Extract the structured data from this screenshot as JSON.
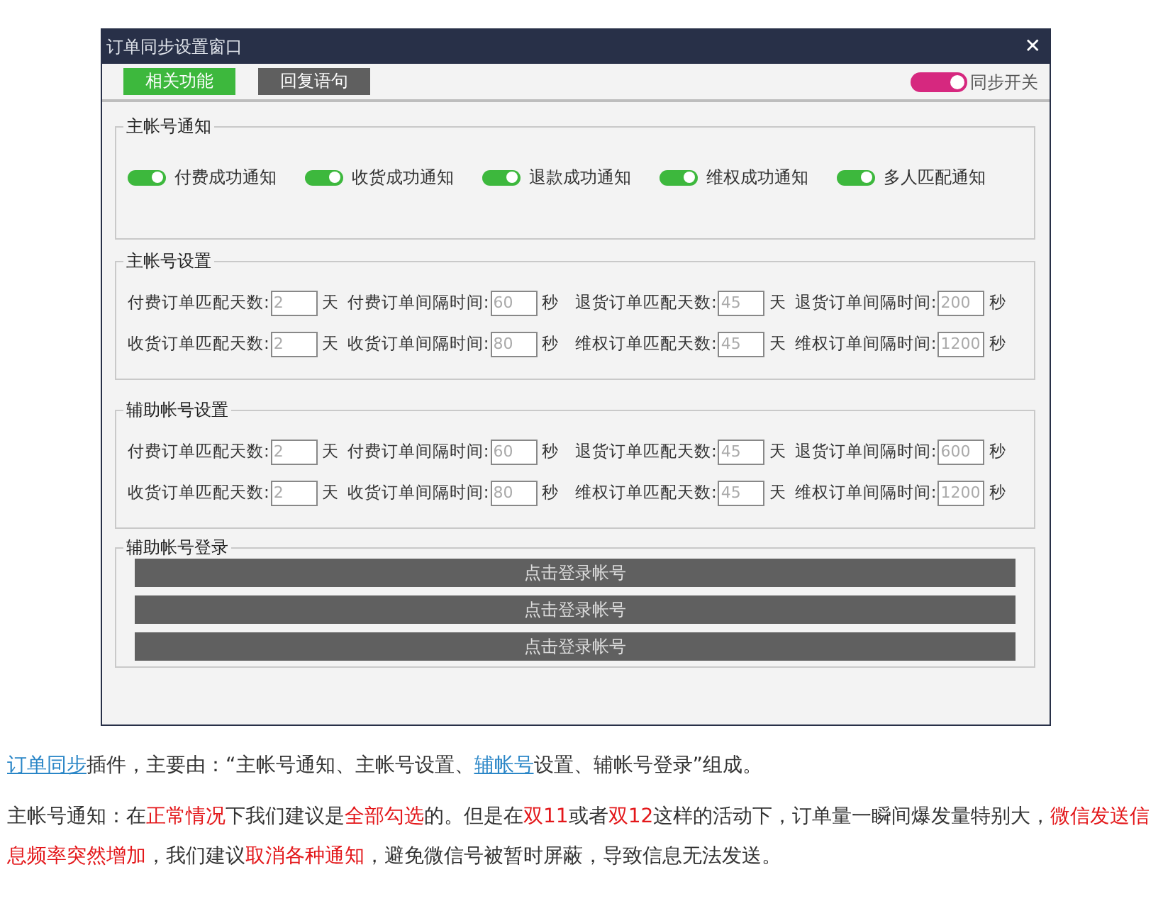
{
  "window": {
    "title": "订单同步设置窗口",
    "close": "✕"
  },
  "tabs": [
    {
      "label": "相关功能",
      "selected": true
    },
    {
      "label": "回复语句",
      "selected": false
    }
  ],
  "sync_switch": {
    "label": "同步开关",
    "on": true
  },
  "notifications": {
    "title": "主帐号通知",
    "items": [
      {
        "label": "付费成功通知",
        "on": true
      },
      {
        "label": "收货成功通知",
        "on": true
      },
      {
        "label": "退款成功通知",
        "on": true
      },
      {
        "label": "维权成功通知",
        "on": true
      },
      {
        "label": "多人匹配通知",
        "on": true
      }
    ]
  },
  "settings_groups": [
    {
      "title": "主帐号设置",
      "rows": [
        [
          {
            "label": "付费订单匹配天数:",
            "value": "2",
            "unit": "天"
          },
          {
            "label": "付费订单间隔时间:",
            "value": "60",
            "unit": "秒"
          },
          {
            "label": "退货订单匹配天数:",
            "value": "45",
            "unit": "天"
          },
          {
            "label": "退货订单间隔时间:",
            "value": "200",
            "unit": "秒"
          }
        ],
        [
          {
            "label": "收货订单匹配天数:",
            "value": "2",
            "unit": "天"
          },
          {
            "label": "收货订单间隔时间:",
            "value": "80",
            "unit": "秒"
          },
          {
            "label": "维权订单匹配天数:",
            "value": "45",
            "unit": "天"
          },
          {
            "label": "维权订单间隔时间:",
            "value": "1200",
            "unit": "秒"
          }
        ]
      ]
    },
    {
      "title": "辅助帐号设置",
      "rows": [
        [
          {
            "label": "付费订单匹配天数:",
            "value": "2",
            "unit": "天"
          },
          {
            "label": "付费订单间隔时间:",
            "value": "60",
            "unit": "秒"
          },
          {
            "label": "退货订单匹配天数:",
            "value": "45",
            "unit": "天"
          },
          {
            "label": "退货订单间隔时间:",
            "value": "600",
            "unit": "秒"
          }
        ],
        [
          {
            "label": "收货订单匹配天数:",
            "value": "2",
            "unit": "天"
          },
          {
            "label": "收货订单间隔时间:",
            "value": "80",
            "unit": "秒"
          },
          {
            "label": "维权订单匹配天数:",
            "value": "45",
            "unit": "天"
          },
          {
            "label": "维权订单间隔时间:",
            "value": "1200",
            "unit": "秒"
          }
        ]
      ]
    }
  ],
  "login": {
    "title": "辅助帐号登录",
    "buttons": [
      "点击登录帐号",
      "点击登录帐号",
      "点击登录帐号"
    ]
  },
  "article": [
    [
      {
        "kind": "link",
        "text": "订单同步"
      },
      {
        "kind": "plain",
        "text": "插件，主要由：“主帐号通知、主帐号设置、"
      },
      {
        "kind": "link",
        "text": "辅帐号"
      },
      {
        "kind": "plain",
        "text": "设置、辅帐号登录”组成。"
      }
    ],
    [
      {
        "kind": "plain",
        "text": "主帐号通知：在"
      },
      {
        "kind": "emphasis",
        "text": "正常情况"
      },
      {
        "kind": "plain",
        "text": "下我们建议是"
      },
      {
        "kind": "emphasis",
        "text": "全部勾选"
      },
      {
        "kind": "plain",
        "text": "的。但是在"
      },
      {
        "kind": "emphasis",
        "text": "双11"
      },
      {
        "kind": "plain",
        "text": "或者"
      },
      {
        "kind": "emphasis",
        "text": "双12"
      },
      {
        "kind": "plain",
        "text": "这样的活动下，订单量一瞬间爆发量特别大，"
      },
      {
        "kind": "emphasis",
        "text": "微信发送信息频率突然增加"
      },
      {
        "kind": "plain",
        "text": "，我们建议"
      },
      {
        "kind": "emphasis",
        "text": "取消各种通知"
      },
      {
        "kind": "plain",
        "text": "，避免微信号被暂时屏蔽，导致信息无法发送。"
      }
    ]
  ]
}
